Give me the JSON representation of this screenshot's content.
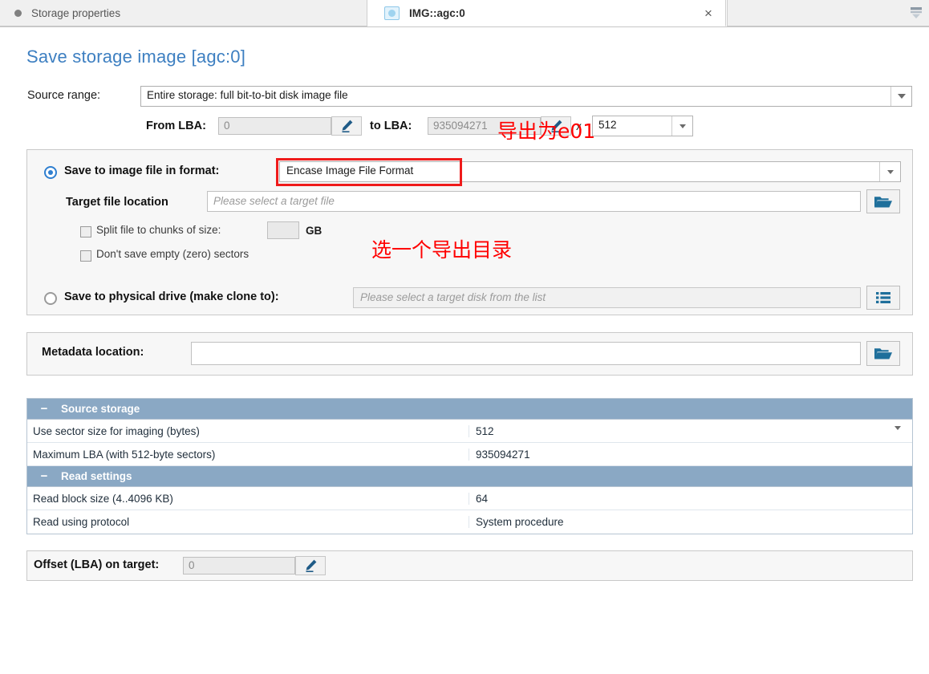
{
  "tabs": {
    "inactive": {
      "label": "Storage properties",
      "icon": "dot-icon"
    },
    "active": {
      "label": "IMG::agc:0",
      "icon": "disk-icon",
      "close_label": "×"
    },
    "overflow_icon": "tab-overflow-icon"
  },
  "page_title": "Save storage image [agc:0]",
  "source_range": {
    "label": "Source range:",
    "value": "Entire storage: full bit-to-bit disk image file",
    "from_lba_label": "From LBA:",
    "from_lba_value": "0",
    "to_lba_label": "to LBA:",
    "to_lba_value": "935094271",
    "multiply_label": "x",
    "sector_size_value": "512",
    "pencil_icon": "pencil-icon"
  },
  "save_options": {
    "file_option_label": "Save to image file in format:",
    "file_option_selected": true,
    "format_value": "Encase Image File Format",
    "target_file_label": "Target file location",
    "target_file_placeholder": "Please select a target file",
    "browse_icon": "folder-open-icon",
    "split_checkbox_label": "Split file to chunks of size:",
    "split_checked": false,
    "split_size_value": "",
    "split_unit_label": "GB",
    "zero_checkbox_label": "Don't save empty (zero) sectors",
    "zero_checked": false,
    "drive_option_label": "Save to physical drive (make clone to):",
    "drive_option_selected": false,
    "drive_placeholder": "Please select a target disk from the list",
    "drive_pick_icon": "list-icon"
  },
  "metadata": {
    "label": "Metadata location:",
    "value": "",
    "browse_icon": "folder-open-icon"
  },
  "properties": {
    "sections": [
      {
        "title": "Source storage",
        "collapse_icon": "minus-icon",
        "rows": [
          {
            "key": "Use sector size for imaging (bytes)",
            "value": "512",
            "has_dropdown": true
          },
          {
            "key": "Maximum LBA (with 512-byte sectors)",
            "value": "935094271",
            "has_dropdown": false
          }
        ]
      },
      {
        "title": "Read settings",
        "collapse_icon": "minus-icon",
        "rows": [
          {
            "key": "Read block size (4..4096 KB)",
            "value": "64",
            "has_dropdown": false
          },
          {
            "key": "Read using protocol",
            "value": "System procedure",
            "has_dropdown": false
          }
        ]
      }
    ]
  },
  "offset": {
    "label": "Offset (LBA) on target:",
    "value": "0",
    "pencil_icon": "pencil-icon"
  },
  "annotations": [
    {
      "text": "导出为e01",
      "color": "#ff0000"
    },
    {
      "text": "选一个导出目录",
      "color": "#ff0000"
    }
  ],
  "colors": {
    "title_blue": "#3d7fc1",
    "section_header": "#8aa8c4",
    "accent_icon_blue": "#1f6f9b",
    "annotation_red": "#ff0000",
    "radio_blue": "#2f7fd0"
  }
}
